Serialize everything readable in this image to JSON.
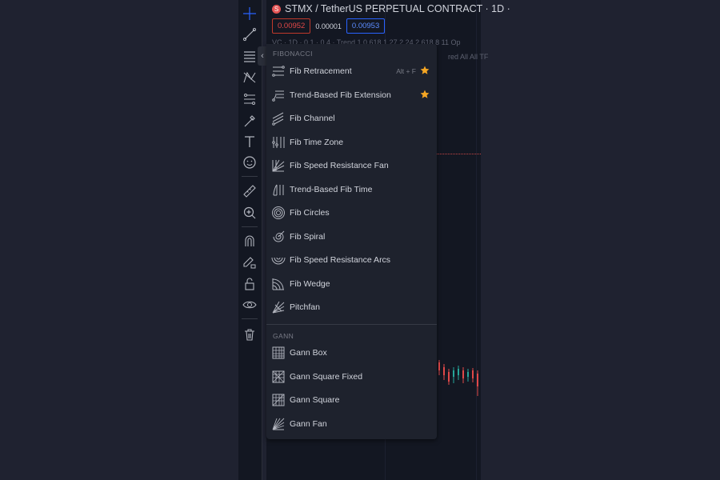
{
  "chart": {
    "title": "STMX / TetherUS PERPETUAL CONTRACT · 1D ·",
    "symbol_logo": "S",
    "sell_price": "0.00952",
    "spread": "0.00001",
    "buy_price": "0.00953",
    "indicator_line_1": "VC · 1D · 0.1 · 0.4 · Trend 1 0.618 1.27 2.24 2.618 8 11 Op",
    "indicator_line_2": "red All All TF"
  },
  "colors": {
    "sell": "#e04848",
    "buy": "#2962ff",
    "star": "#f5a623",
    "accent": "#2962ff"
  },
  "menu": {
    "fib_section_title": "FIBONACCI",
    "gann_section_title": "GANN",
    "fib_items": [
      {
        "label": "Fib Retracement",
        "icon": "fib-retracement-icon",
        "hotkey": "Alt + F",
        "favorite": true
      },
      {
        "label": "Trend-Based Fib Extension",
        "icon": "trend-based-fib-extension-icon",
        "hotkey": "",
        "favorite": true
      },
      {
        "label": "Fib Channel",
        "icon": "fib-channel-icon",
        "hotkey": "",
        "favorite": false
      },
      {
        "label": "Fib Time Zone",
        "icon": "fib-time-zone-icon",
        "hotkey": "",
        "favorite": false
      },
      {
        "label": "Fib Speed Resistance Fan",
        "icon": "fib-speed-resistance-fan-icon",
        "hotkey": "",
        "favorite": false
      },
      {
        "label": "Trend-Based Fib Time",
        "icon": "trend-based-fib-time-icon",
        "hotkey": "",
        "favorite": false
      },
      {
        "label": "Fib Circles",
        "icon": "fib-circles-icon",
        "hotkey": "",
        "favorite": false
      },
      {
        "label": "Fib Spiral",
        "icon": "fib-spiral-icon",
        "hotkey": "",
        "favorite": false
      },
      {
        "label": "Fib Speed Resistance Arcs",
        "icon": "fib-speed-resistance-arcs-icon",
        "hotkey": "",
        "favorite": false
      },
      {
        "label": "Fib Wedge",
        "icon": "fib-wedge-icon",
        "hotkey": "",
        "favorite": false
      },
      {
        "label": "Pitchfan",
        "icon": "pitchfan-icon",
        "hotkey": "",
        "favorite": false
      }
    ],
    "gann_items": [
      {
        "label": "Gann Box",
        "icon": "gann-box-icon"
      },
      {
        "label": "Gann Square Fixed",
        "icon": "gann-square-fixed-icon"
      },
      {
        "label": "Gann Square",
        "icon": "gann-square-icon"
      },
      {
        "label": "Gann Fan",
        "icon": "gann-fan-icon"
      }
    ]
  },
  "toolbar": {
    "icons": [
      "crosshair-icon",
      "trend-line-icon",
      "fib-tools-icon",
      "patterns-icon",
      "prediction-icon",
      "brush-icon",
      "text-icon",
      "emoji-icon",
      "ruler-icon",
      "zoom-icon",
      "magnet-icon",
      "lock-drawing-icon",
      "lock-icon",
      "eye-icon",
      "trash-icon"
    ]
  }
}
